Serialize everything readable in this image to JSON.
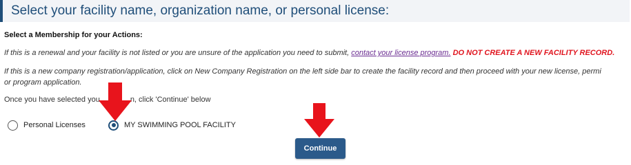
{
  "header": {
    "title": "Select your facility name, organization name, or personal license:"
  },
  "section": {
    "label": "Select a Membership for your Actions:"
  },
  "renewal_note": {
    "text_before": "If this is a renewal and your facility is not listed or you are unsure of the application you need to submit, ",
    "link_text": "contact your license program.",
    "warning": "DO NOT CREATE A NEW FACILITY RECORD."
  },
  "new_registration_note": {
    "line1": "If this is a new company registration/application, click on New Company Registration on the left side bar to create the facility record and then proceed with your new license, permi",
    "line2": "or program application."
  },
  "instruction": {
    "before": "Once you have selected you",
    "after": "n, click 'Continue' below"
  },
  "options": [
    {
      "label": "Personal Licenses",
      "selected": false
    },
    {
      "label": "MY SWIMMING POOL FACILITY",
      "selected": true
    }
  ],
  "continue_button": {
    "label": "Continue"
  },
  "colors": {
    "accent": "#1f4e79",
    "warning": "#e0141e",
    "link": "#6a2c91",
    "arrow": "#e8141c"
  }
}
